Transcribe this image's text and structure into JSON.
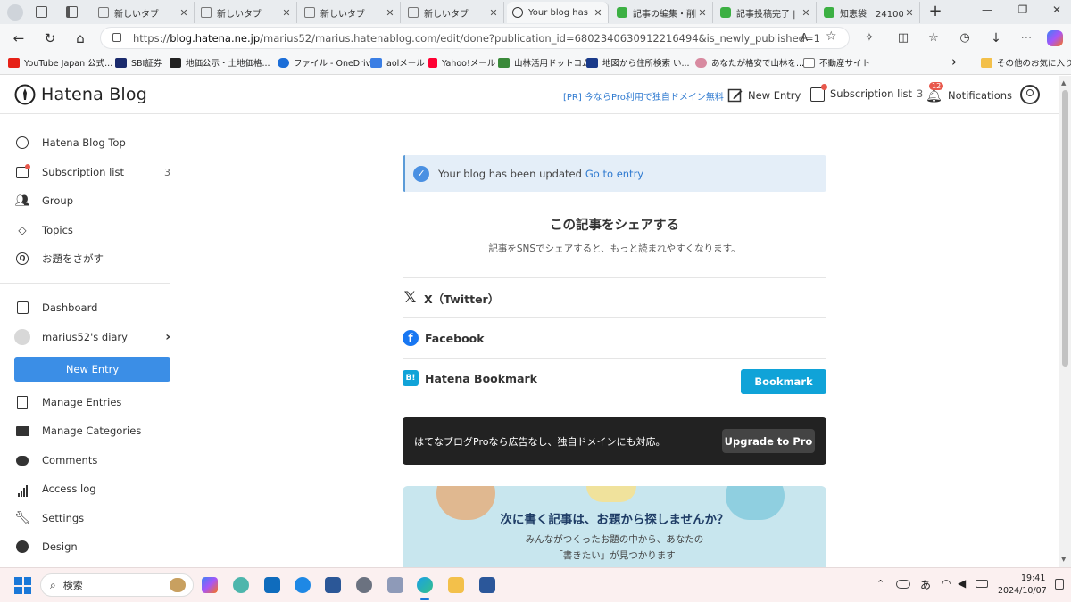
{
  "browser": {
    "tabs": [
      {
        "title": "新しいタブ",
        "icon": "page-icon"
      },
      {
        "title": "新しいタブ",
        "icon": "page-icon"
      },
      {
        "title": "新しいタブ",
        "icon": "page-icon"
      },
      {
        "title": "新しいタブ",
        "icon": "page-icon"
      },
      {
        "title": "Your blog has be",
        "icon": "hatena-blog-icon"
      },
      {
        "title": "記事の編集・削除",
        "icon": "frog-icon"
      },
      {
        "title": "記事投稿完了 |",
        "icon": "frog-icon"
      },
      {
        "title": "知恵袋　24100",
        "icon": "frog-icon"
      }
    ],
    "new_tab_symbol": "+",
    "url_prefix": "https://",
    "url_host": "blog.hatena.ne.jp",
    "url_path": "/marius52/marius.hatenablog.com/edit/done?publication_id=6802340630912216494&is_newly_published=1",
    "bookmarks": [
      {
        "label": "YouTube Japan 公式...",
        "color": "#e62117"
      },
      {
        "label": "SBI証券",
        "color": "#1a2a6c"
      },
      {
        "label": "地価公示・土地価格...",
        "color": "#222222"
      },
      {
        "label": "ファイル - OneDrive",
        "color": "#1c6ed8"
      },
      {
        "label": "aolメール",
        "color": "#3a7ee4"
      },
      {
        "label": "Yahoo!メール",
        "color": "#ff0033"
      },
      {
        "label": "山林活用ドットコム",
        "color": "#3a8a3a"
      },
      {
        "label": "地図から住所検索 い...",
        "color": "#1a3a8a"
      },
      {
        "label": "あなたが格安で山林を...",
        "color": "#d88aa0"
      },
      {
        "label": "不動産サイト",
        "color": "#ffffff"
      }
    ],
    "bookmarks_more_symbol": "›",
    "other_favorites": "その他のお気に入り"
  },
  "header": {
    "logo_text": "Hatena Blog",
    "promo": "[PR] 今ならPro利用で独自ドメイン無料",
    "new_entry": "New Entry",
    "subscription": "Subscription list",
    "subscription_count": "3",
    "notifications": "Notifications",
    "notifications_badge": "12"
  },
  "sidebar": {
    "items_top": [
      {
        "label": "Hatena Blog Top",
        "icon": "hatena-circle-icon"
      },
      {
        "label": "Subscription list",
        "icon": "subscription-icon",
        "count": "3"
      },
      {
        "label": "Group",
        "icon": "group-icon"
      },
      {
        "label": "Topics",
        "icon": "topics-icon"
      },
      {
        "label": "お題をさがす",
        "icon": "question-circle-icon"
      }
    ],
    "dashboard": "Dashboard",
    "blog_name": "marius52's diary",
    "new_entry_button": "New Entry",
    "items_bottom": [
      {
        "label": "Manage Entries",
        "icon": "document-icon"
      },
      {
        "label": "Manage Categories",
        "icon": "folder-icon"
      },
      {
        "label": "Comments",
        "icon": "comment-icon"
      },
      {
        "label": "Access log",
        "icon": "bar-chart-icon"
      },
      {
        "label": "Settings",
        "icon": "wrench-icon"
      },
      {
        "label": "Design",
        "icon": "palette-icon"
      }
    ]
  },
  "main": {
    "alert_text": "Your blog has been updated",
    "alert_link": "Go to entry",
    "share_title": "この記事をシェアする",
    "share_subtitle": "記事をSNSでシェアすると、もっと読まれやすくなります。",
    "share_x": "X（Twitter）",
    "share_facebook": "Facebook",
    "share_hatena": "Hatena Bookmark",
    "bookmark_button": "Bookmark",
    "pro_text": "はてなブログProなら広告なし、独自ドメインにも対応。",
    "upgrade_button": "Upgrade to Pro",
    "topic_title": "次に書く記事は、お題から探しませんか？",
    "topic_line1": "みんながつくったお題の中から、あなたの",
    "topic_line2": "「書きたい」が見つかります"
  },
  "taskbar": {
    "search_placeholder": "検索",
    "ime": "あ",
    "time": "19:41",
    "date": "2024/10/07"
  },
  "colors": {
    "primary_blue": "#3b8ee6",
    "bookmark_blue": "#10a3d8",
    "alert_bg": "#e4eef8",
    "link": "#2f7ad0",
    "pro_dark": "#222222"
  }
}
